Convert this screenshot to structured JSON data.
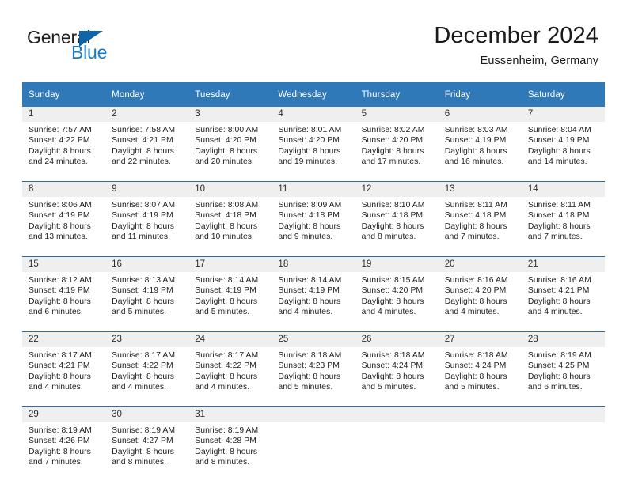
{
  "brand": {
    "word_one": "General",
    "word_two": "Blue",
    "mark": "triangle-icon"
  },
  "header": {
    "month_title": "December 2024",
    "location": "Eussenheim, Germany"
  },
  "colors": {
    "header_blue": "#3079b9",
    "row_divider_blue": "#2e6da4",
    "daynum_band": "#efefef",
    "brand_blue": "#1a7ac4",
    "brand_mark_blue": "#1064a8",
    "text": "#1a1a1a"
  },
  "calendar": {
    "weekday_headers": [
      "Sunday",
      "Monday",
      "Tuesday",
      "Wednesday",
      "Thursday",
      "Friday",
      "Saturday"
    ],
    "labels": {
      "sunrise": "Sunrise:",
      "sunset": "Sunset:",
      "daylight": "Daylight:"
    },
    "weeks": [
      [
        {
          "day": "1",
          "sunrise": "Sunrise: 7:57 AM",
          "sunset": "Sunset: 4:22 PM",
          "daylight_line1": "Daylight: 8 hours",
          "daylight_line2": "and 24 minutes."
        },
        {
          "day": "2",
          "sunrise": "Sunrise: 7:58 AM",
          "sunset": "Sunset: 4:21 PM",
          "daylight_line1": "Daylight: 8 hours",
          "daylight_line2": "and 22 minutes."
        },
        {
          "day": "3",
          "sunrise": "Sunrise: 8:00 AM",
          "sunset": "Sunset: 4:20 PM",
          "daylight_line1": "Daylight: 8 hours",
          "daylight_line2": "and 20 minutes."
        },
        {
          "day": "4",
          "sunrise": "Sunrise: 8:01 AM",
          "sunset": "Sunset: 4:20 PM",
          "daylight_line1": "Daylight: 8 hours",
          "daylight_line2": "and 19 minutes."
        },
        {
          "day": "5",
          "sunrise": "Sunrise: 8:02 AM",
          "sunset": "Sunset: 4:20 PM",
          "daylight_line1": "Daylight: 8 hours",
          "daylight_line2": "and 17 minutes."
        },
        {
          "day": "6",
          "sunrise": "Sunrise: 8:03 AM",
          "sunset": "Sunset: 4:19 PM",
          "daylight_line1": "Daylight: 8 hours",
          "daylight_line2": "and 16 minutes."
        },
        {
          "day": "7",
          "sunrise": "Sunrise: 8:04 AM",
          "sunset": "Sunset: 4:19 PM",
          "daylight_line1": "Daylight: 8 hours",
          "daylight_line2": "and 14 minutes."
        }
      ],
      [
        {
          "day": "8",
          "sunrise": "Sunrise: 8:06 AM",
          "sunset": "Sunset: 4:19 PM",
          "daylight_line1": "Daylight: 8 hours",
          "daylight_line2": "and 13 minutes."
        },
        {
          "day": "9",
          "sunrise": "Sunrise: 8:07 AM",
          "sunset": "Sunset: 4:19 PM",
          "daylight_line1": "Daylight: 8 hours",
          "daylight_line2": "and 11 minutes."
        },
        {
          "day": "10",
          "sunrise": "Sunrise: 8:08 AM",
          "sunset": "Sunset: 4:18 PM",
          "daylight_line1": "Daylight: 8 hours",
          "daylight_line2": "and 10 minutes."
        },
        {
          "day": "11",
          "sunrise": "Sunrise: 8:09 AM",
          "sunset": "Sunset: 4:18 PM",
          "daylight_line1": "Daylight: 8 hours",
          "daylight_line2": "and 9 minutes."
        },
        {
          "day": "12",
          "sunrise": "Sunrise: 8:10 AM",
          "sunset": "Sunset: 4:18 PM",
          "daylight_line1": "Daylight: 8 hours",
          "daylight_line2": "and 8 minutes."
        },
        {
          "day": "13",
          "sunrise": "Sunrise: 8:11 AM",
          "sunset": "Sunset: 4:18 PM",
          "daylight_line1": "Daylight: 8 hours",
          "daylight_line2": "and 7 minutes."
        },
        {
          "day": "14",
          "sunrise": "Sunrise: 8:11 AM",
          "sunset": "Sunset: 4:18 PM",
          "daylight_line1": "Daylight: 8 hours",
          "daylight_line2": "and 7 minutes."
        }
      ],
      [
        {
          "day": "15",
          "sunrise": "Sunrise: 8:12 AM",
          "sunset": "Sunset: 4:19 PM",
          "daylight_line1": "Daylight: 8 hours",
          "daylight_line2": "and 6 minutes."
        },
        {
          "day": "16",
          "sunrise": "Sunrise: 8:13 AM",
          "sunset": "Sunset: 4:19 PM",
          "daylight_line1": "Daylight: 8 hours",
          "daylight_line2": "and 5 minutes."
        },
        {
          "day": "17",
          "sunrise": "Sunrise: 8:14 AM",
          "sunset": "Sunset: 4:19 PM",
          "daylight_line1": "Daylight: 8 hours",
          "daylight_line2": "and 5 minutes."
        },
        {
          "day": "18",
          "sunrise": "Sunrise: 8:14 AM",
          "sunset": "Sunset: 4:19 PM",
          "daylight_line1": "Daylight: 8 hours",
          "daylight_line2": "and 4 minutes."
        },
        {
          "day": "19",
          "sunrise": "Sunrise: 8:15 AM",
          "sunset": "Sunset: 4:20 PM",
          "daylight_line1": "Daylight: 8 hours",
          "daylight_line2": "and 4 minutes."
        },
        {
          "day": "20",
          "sunrise": "Sunrise: 8:16 AM",
          "sunset": "Sunset: 4:20 PM",
          "daylight_line1": "Daylight: 8 hours",
          "daylight_line2": "and 4 minutes."
        },
        {
          "day": "21",
          "sunrise": "Sunrise: 8:16 AM",
          "sunset": "Sunset: 4:21 PM",
          "daylight_line1": "Daylight: 8 hours",
          "daylight_line2": "and 4 minutes."
        }
      ],
      [
        {
          "day": "22",
          "sunrise": "Sunrise: 8:17 AM",
          "sunset": "Sunset: 4:21 PM",
          "daylight_line1": "Daylight: 8 hours",
          "daylight_line2": "and 4 minutes."
        },
        {
          "day": "23",
          "sunrise": "Sunrise: 8:17 AM",
          "sunset": "Sunset: 4:22 PM",
          "daylight_line1": "Daylight: 8 hours",
          "daylight_line2": "and 4 minutes."
        },
        {
          "day": "24",
          "sunrise": "Sunrise: 8:17 AM",
          "sunset": "Sunset: 4:22 PM",
          "daylight_line1": "Daylight: 8 hours",
          "daylight_line2": "and 4 minutes."
        },
        {
          "day": "25",
          "sunrise": "Sunrise: 8:18 AM",
          "sunset": "Sunset: 4:23 PM",
          "daylight_line1": "Daylight: 8 hours",
          "daylight_line2": "and 5 minutes."
        },
        {
          "day": "26",
          "sunrise": "Sunrise: 8:18 AM",
          "sunset": "Sunset: 4:24 PM",
          "daylight_line1": "Daylight: 8 hours",
          "daylight_line2": "and 5 minutes."
        },
        {
          "day": "27",
          "sunrise": "Sunrise: 8:18 AM",
          "sunset": "Sunset: 4:24 PM",
          "daylight_line1": "Daylight: 8 hours",
          "daylight_line2": "and 5 minutes."
        },
        {
          "day": "28",
          "sunrise": "Sunrise: 8:19 AM",
          "sunset": "Sunset: 4:25 PM",
          "daylight_line1": "Daylight: 8 hours",
          "daylight_line2": "and 6 minutes."
        }
      ],
      [
        {
          "day": "29",
          "sunrise": "Sunrise: 8:19 AM",
          "sunset": "Sunset: 4:26 PM",
          "daylight_line1": "Daylight: 8 hours",
          "daylight_line2": "and 7 minutes."
        },
        {
          "day": "30",
          "sunrise": "Sunrise: 8:19 AM",
          "sunset": "Sunset: 4:27 PM",
          "daylight_line1": "Daylight: 8 hours",
          "daylight_line2": "and 8 minutes."
        },
        {
          "day": "31",
          "sunrise": "Sunrise: 8:19 AM",
          "sunset": "Sunset: 4:28 PM",
          "daylight_line1": "Daylight: 8 hours",
          "daylight_line2": "and 8 minutes."
        },
        {
          "day": "",
          "sunrise": "",
          "sunset": "",
          "daylight_line1": "",
          "daylight_line2": ""
        },
        {
          "day": "",
          "sunrise": "",
          "sunset": "",
          "daylight_line1": "",
          "daylight_line2": ""
        },
        {
          "day": "",
          "sunrise": "",
          "sunset": "",
          "daylight_line1": "",
          "daylight_line2": ""
        },
        {
          "day": "",
          "sunrise": "",
          "sunset": "",
          "daylight_line1": "",
          "daylight_line2": ""
        }
      ]
    ]
  }
}
